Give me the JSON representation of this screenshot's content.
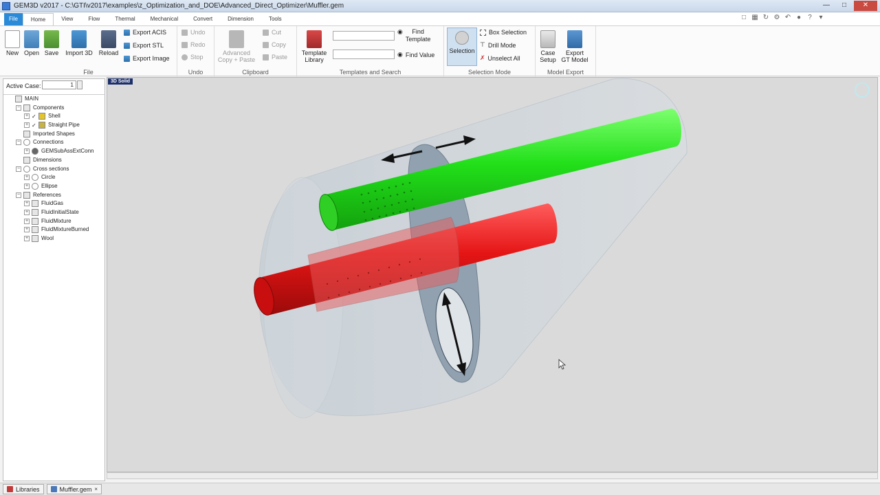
{
  "window": {
    "title": "GEM3D v2017 - C:\\GTI\\v2017\\examples\\z_Optimization_and_DOE\\Advanced_Direct_Optimizer\\Muffler.gem"
  },
  "tabs": [
    "File",
    "Home",
    "View",
    "Flow",
    "Thermal",
    "Mechanical",
    "Convert",
    "Dimension",
    "Tools"
  ],
  "ribbon": {
    "file": {
      "label": "File",
      "new": "New",
      "open": "Open",
      "save": "Save",
      "import3d": "Import 3D",
      "reload": "Reload",
      "export_acis": "Export ACIS",
      "export_stl": "Export STL",
      "export_image": "Export Image"
    },
    "undo": {
      "label": "Undo",
      "undo": "Undo",
      "redo": "Redo",
      "stop": "Stop"
    },
    "clipboard": {
      "label": "Clipboard",
      "advanced_1": "Advanced",
      "advanced_2": "Copy + Paste",
      "cut": "Cut",
      "copy": "Copy",
      "paste": "Paste"
    },
    "templates": {
      "label": "Templates and Search",
      "template_library_1": "Template",
      "template_library_2": "Library",
      "find_template_1": "Find",
      "find_template_2": "Template",
      "find_value": "Find Value"
    },
    "selection": {
      "label": "Selection Mode",
      "selection": "Selection",
      "box_selection": "Box Selection",
      "drill_mode": "Drill Mode",
      "unselect_all": "Unselect All"
    },
    "model_export": {
      "label": "Model Export",
      "case_setup_1": "Case",
      "case_setup_2": "Setup",
      "export_gt_1": "Export",
      "export_gt_2": "GT Model"
    }
  },
  "left_panel": {
    "active_case_label": "Active Case:",
    "active_case_value": "1",
    "tree": [
      {
        "label": "MAIN",
        "level": 0,
        "expander": false,
        "icon": "square"
      },
      {
        "label": "Components",
        "level": 1,
        "expander": true,
        "icon": "square"
      },
      {
        "label": "Shell",
        "level": 2,
        "expander": true,
        "check": true,
        "icon": "shell"
      },
      {
        "label": "Straight Pipe",
        "level": 2,
        "expander": true,
        "check": true,
        "icon": "pipe"
      },
      {
        "label": "Imported Shapes",
        "level": 1,
        "expander": false,
        "icon": "square"
      },
      {
        "label": "Connections",
        "level": 1,
        "expander": true,
        "icon": "round"
      },
      {
        "label": "GEMSubAssExtConn",
        "level": 2,
        "expander": true,
        "icon": "conn"
      },
      {
        "label": "Dimensions",
        "level": 1,
        "expander": false,
        "icon": "square"
      },
      {
        "label": "Cross sections",
        "level": 1,
        "expander": true,
        "icon": "round"
      },
      {
        "label": "Circle",
        "level": 2,
        "expander": true,
        "icon": "round"
      },
      {
        "label": "Ellipse",
        "level": 2,
        "expander": true,
        "icon": "round"
      },
      {
        "label": "References",
        "level": 1,
        "expander": true,
        "icon": "square"
      },
      {
        "label": "FluidGas",
        "level": 2,
        "expander": true,
        "icon": "square"
      },
      {
        "label": "FluidInitialState",
        "level": 2,
        "expander": true,
        "icon": "square"
      },
      {
        "label": "FluidMixture",
        "level": 2,
        "expander": true,
        "icon": "square"
      },
      {
        "label": "FluidMixtureBurned",
        "level": 2,
        "expander": true,
        "icon": "square"
      },
      {
        "label": "Wool",
        "level": 2,
        "expander": true,
        "icon": "square"
      }
    ]
  },
  "viewport": {
    "badge": "3D Solid"
  },
  "doc_tabs": {
    "libraries": "Libraries",
    "muffler": "Muffler.gem",
    "close": "×"
  },
  "colors": {
    "green_pipe": "#22e01a",
    "red_pipe": "#e51515",
    "shell": "#c9d3da",
    "accent": "#2a8ad8"
  }
}
